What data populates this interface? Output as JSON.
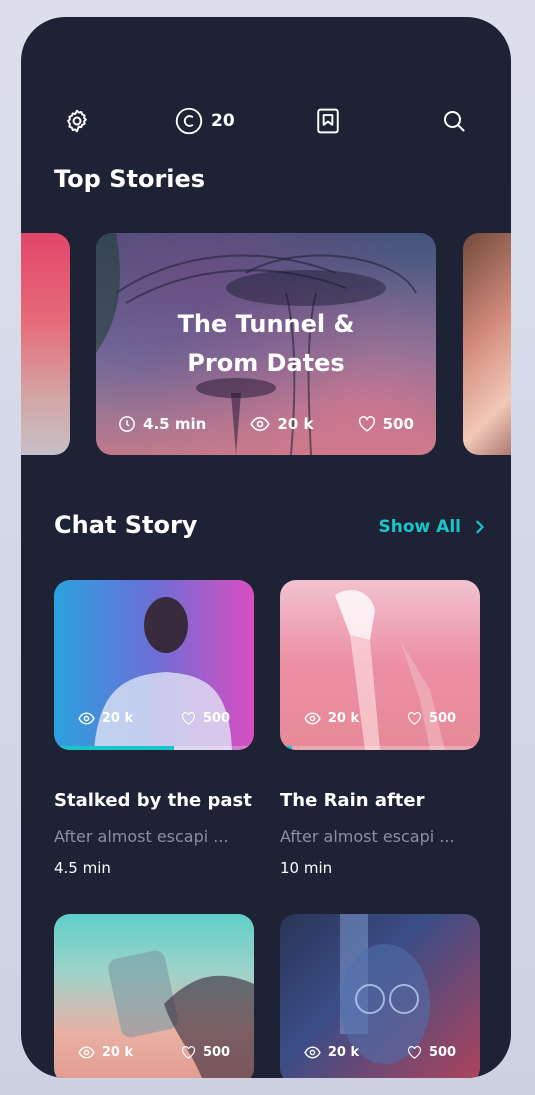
{
  "header": {
    "coins": "20",
    "icons": [
      "gear-icon",
      "coin-icon",
      "bookmark-icon",
      "search-icon"
    ]
  },
  "top_stories": {
    "title": "Top Stories",
    "featured": {
      "title_line1": "The Tunnel &",
      "title_line2": "Prom Dates",
      "time": "4.5 min",
      "views": "20 k",
      "likes": "500"
    }
  },
  "chat_story": {
    "title": "Chat Story",
    "show_all": "Show All",
    "cards": [
      {
        "title": "Stalked by the past",
        "desc": "After almost escapi ...",
        "time": "4.5 min",
        "views": "20 k",
        "likes": "500",
        "progress": 0.6
      },
      {
        "title": "The Rain after",
        "desc": "After almost escapi ...",
        "time": "10 min",
        "views": "20 k",
        "likes": "500",
        "progress": 0.06
      },
      {
        "views": "20 k",
        "likes": "500"
      },
      {
        "views": "20 k",
        "likes": "500"
      }
    ]
  },
  "colors": {
    "accent": "#19c6c7",
    "background": "#1e2235",
    "text_muted": "#8b8fa3"
  }
}
